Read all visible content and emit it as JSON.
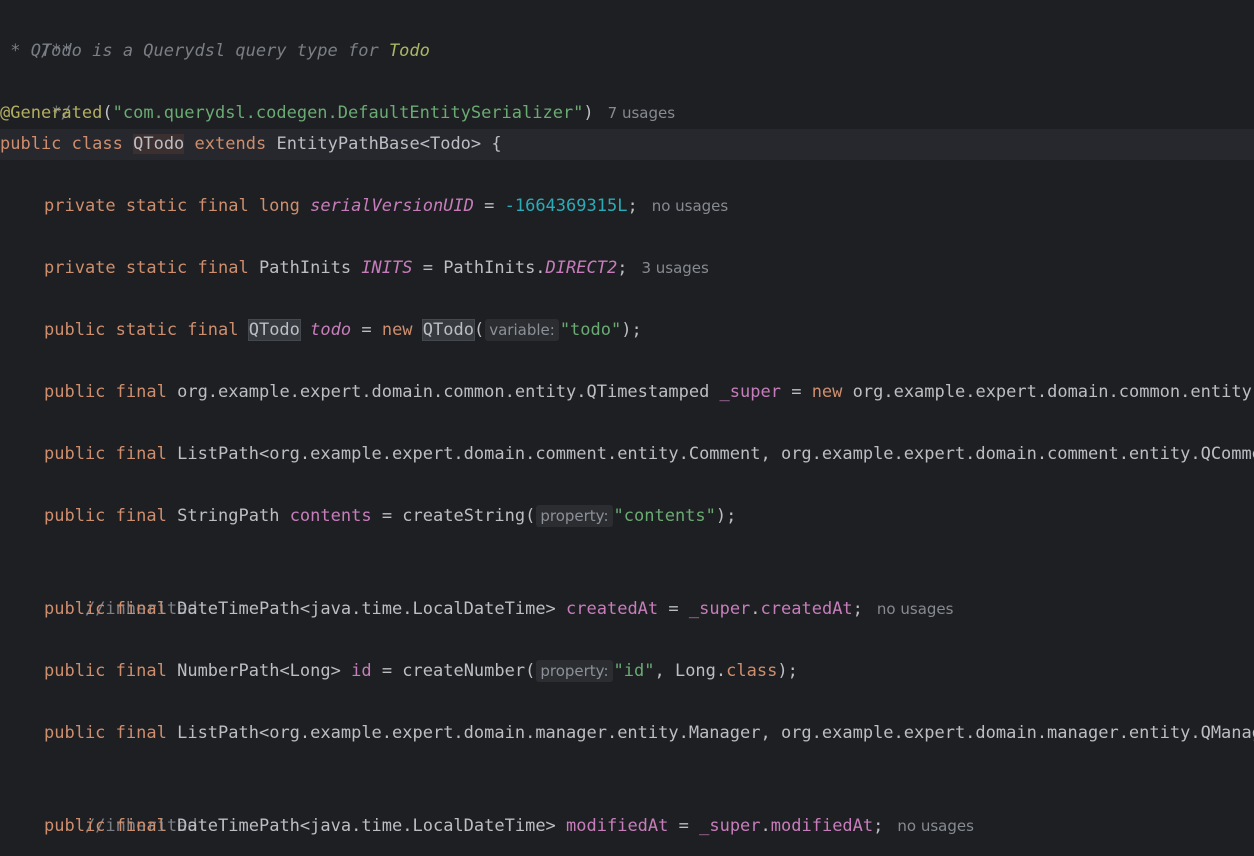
{
  "editor": {
    "javadoc": {
      "open": "/**",
      "text": " * QTodo is a Querydsl query type for ",
      "link": "Todo",
      "close": " */"
    },
    "annotation": {
      "name": "@Generated",
      "open": "(",
      "arg": "\"com.querydsl.codegen.DefaultEntitySerializer\"",
      "close": ")",
      "usages": "7 usages"
    },
    "class_decl": {
      "kw1": "public",
      "kw2": "class",
      "name": "QTodo",
      "kw3": "extends",
      "rest": "EntityPathBase<Todo> {"
    },
    "serial": {
      "mods": "private static final long",
      "name": "serialVersionUID",
      "eq": " = ",
      "value": "-1664369315L",
      "end": ";",
      "usages": "no usages"
    },
    "inits": {
      "mods": "private static final",
      "type": " PathInits ",
      "name": "INITS",
      "rhs": " = PathInits.",
      "const": "DIRECT2",
      "end": ";",
      "usages": "3 usages"
    },
    "todo_field": {
      "mods": "public static final",
      "type": "QTodo",
      "name": "todo",
      "eq": " = ",
      "new_kw": "new",
      "ctor": "QTodo",
      "open": "(",
      "hint": "variable:",
      "arg": "\"todo\"",
      "end": ");"
    },
    "super_field": {
      "mods1": "public",
      "mods2": "final",
      "type": " org.example.expert.domain.common.entity.QTimestamped ",
      "name": "_super",
      "eq": " = ",
      "new_kw": "new",
      "rest": " org.example.expert.domain.common.entity.QTimestamped(this);"
    },
    "comments_field": {
      "mods1": "public",
      "mods2": "final",
      "type": " ListPath<org.example.expert.domain.comment.entity.Comment, org.example.expert.domain.comment.entity.QComment> comments"
    },
    "contents_field": {
      "mods1": "public",
      "mods2": "final",
      "type": " StringPath ",
      "name": "contents",
      "rhs": " = createString(",
      "hint": "property:",
      "arg": "\"contents\"",
      "end": ");"
    },
    "inherited_1": "//inherited",
    "created_field": {
      "mods1": "public",
      "mods2": "final",
      "type": " DateTimePath<java.time.LocalDateTime> ",
      "name": "createdAt",
      "eq": " = ",
      "sup": "_super",
      "dot": ".",
      "ref": "createdAt",
      "end": ";",
      "usages": "no usages"
    },
    "id_field": {
      "mods1": "public",
      "mods2": "final",
      "type": " NumberPath<Long> ",
      "name": "id",
      "rhs": " = createNumber(",
      "hint": "property:",
      "arg": "\"id\"",
      "mid": ", Long.",
      "cls_kw": "class",
      "end": ");"
    },
    "managers_field": {
      "mods1": "public",
      "mods2": "final",
      "type": " ListPath<org.example.expert.domain.manager.entity.Manager, org.example.expert.domain.manager.entity.QManager> managers"
    },
    "inherited_2": "//inherited",
    "modified_field": {
      "mods1": "public",
      "mods2": "final",
      "type": " DateTimePath<java.time.LocalDateTime> ",
      "name": "modifiedAt",
      "eq": " = ",
      "sup": "_super",
      "dot": ".",
      "ref": "modifiedAt",
      "end": ";",
      "usages": "no usages"
    }
  }
}
